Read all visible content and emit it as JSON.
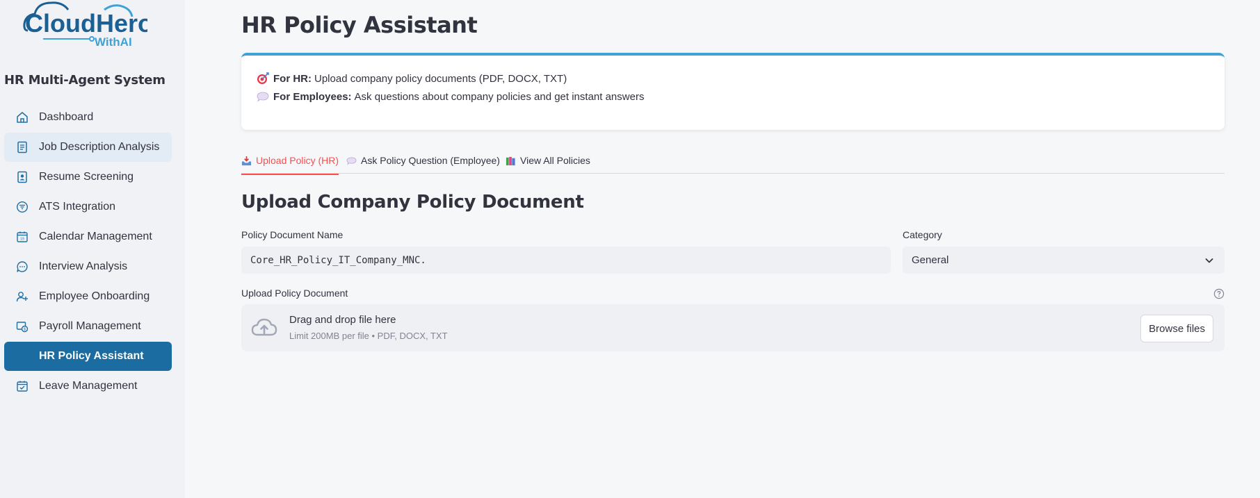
{
  "brand": {
    "logo_text_main": "CloudHero",
    "logo_text_sub": "WithAI",
    "colors": {
      "primary": "#1b6ca0",
      "accent": "#3fa1d6",
      "active_tab": "#ff4b4b"
    }
  },
  "sidebar": {
    "title": "HR Multi-Agent System",
    "items": [
      {
        "label": "Dashboard",
        "icon": "home-icon"
      },
      {
        "label": "Job Description Analysis",
        "icon": "document-icon"
      },
      {
        "label": "Resume Screening",
        "icon": "id-badge-icon"
      },
      {
        "label": "ATS Integration",
        "icon": "filter-icon"
      },
      {
        "label": "Calendar Management",
        "icon": "calendar-icon"
      },
      {
        "label": "Interview Analysis",
        "icon": "chat-icon"
      },
      {
        "label": "Employee Onboarding",
        "icon": "add-user-icon"
      },
      {
        "label": "Payroll Management",
        "icon": "payroll-icon"
      },
      {
        "label": "HR Policy Assistant",
        "icon": "policy-icon",
        "active": true
      },
      {
        "label": "Leave Management",
        "icon": "calendar-check-icon"
      }
    ]
  },
  "main": {
    "title": "HR Policy Assistant",
    "info": {
      "hr_label": "For HR:",
      "hr_text": "Upload company policy documents (PDF, DOCX, TXT)",
      "emp_label": "For Employees:",
      "emp_text": "Ask questions about company policies and get instant answers"
    },
    "tabs": [
      {
        "label": "Upload Policy (HR)",
        "icon": "inbox-tray-icon",
        "active": true
      },
      {
        "label": "Ask Policy Question (Employee)",
        "icon": "speech-bubble-icon"
      },
      {
        "label": "View All Policies",
        "icon": "books-icon"
      }
    ],
    "section_title": "Upload Company Policy Document",
    "form": {
      "name_label": "Policy Document Name",
      "name_value": "Core_HR_Policy_IT_Company_MNC.",
      "category_label": "Category",
      "category_value": "General",
      "upload_label": "Upload Policy Document",
      "dropzone_title": "Drag and drop file here",
      "dropzone_limit": "Limit 200MB per file • PDF, DOCX, TXT",
      "browse_label": "Browse files"
    }
  }
}
